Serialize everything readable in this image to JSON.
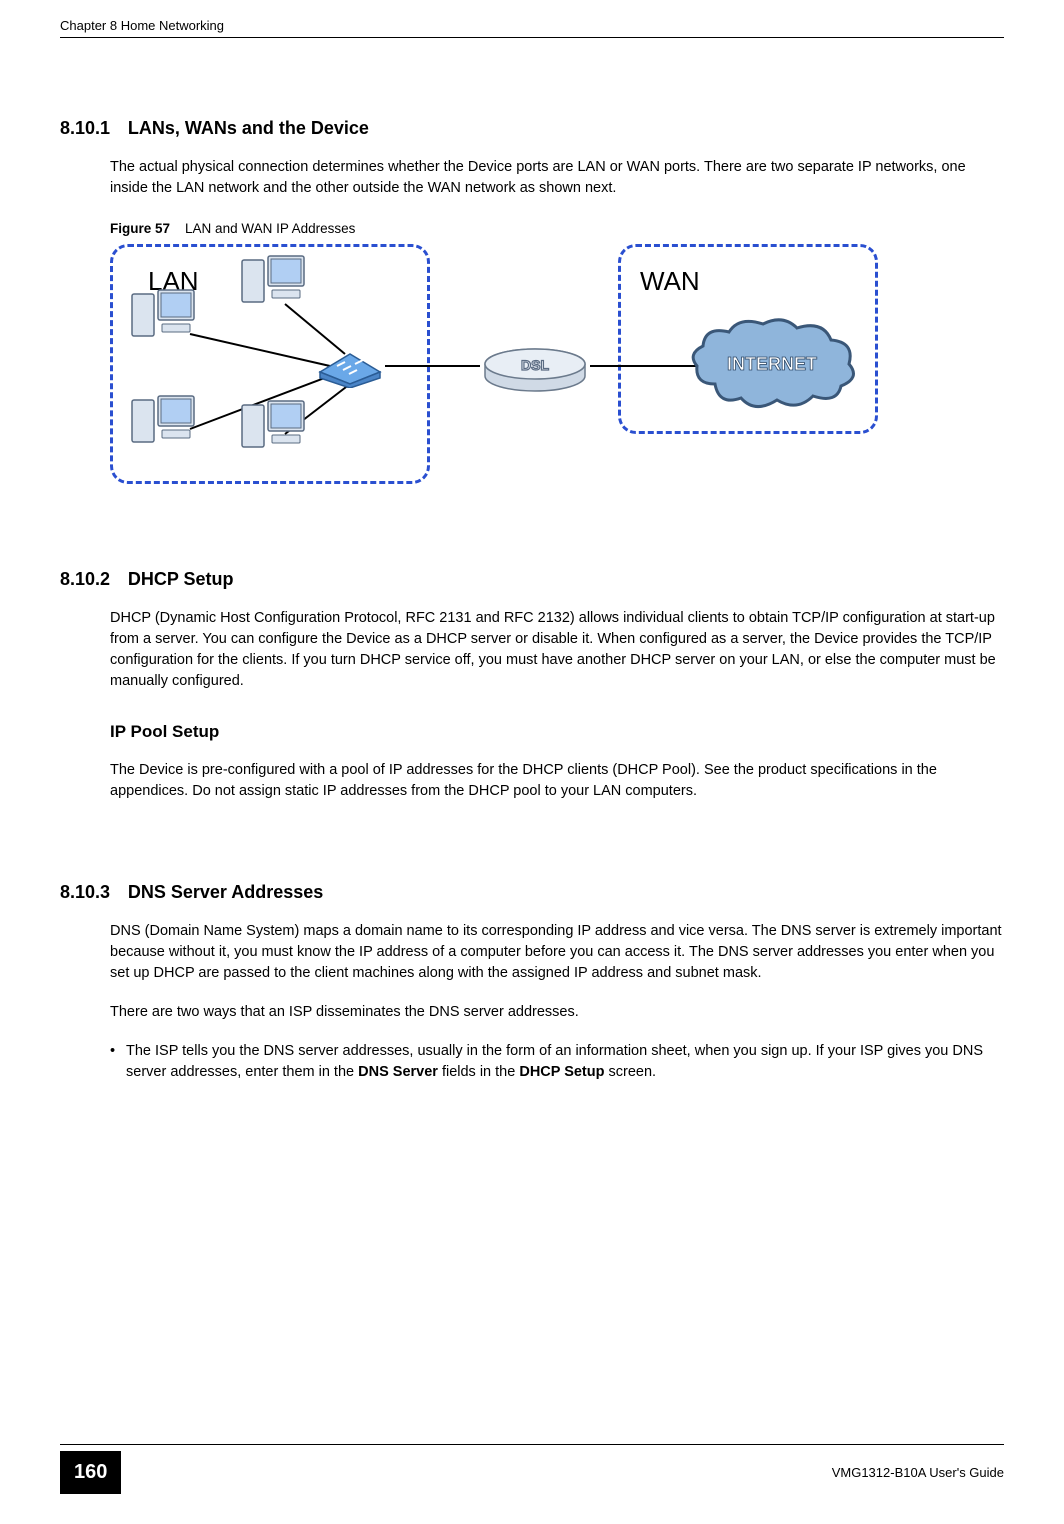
{
  "header": {
    "chapter": "Chapter 8 Home Networking"
  },
  "sections": {
    "s1": {
      "num": "8.10.1",
      "title": "LANs, WANs and the Device",
      "body": "The actual physical connection determines whether the Device ports are LAN or WAN ports. There are two separate IP networks, one inside the LAN network and the other outside the WAN network as shown next."
    },
    "figure": {
      "label": "Figure 57",
      "caption": "LAN and WAN IP Addresses",
      "lan_label": "LAN",
      "wan_label": "WAN",
      "dsl_text": "DSL",
      "internet_text": "INTERNET"
    },
    "s2": {
      "num": "8.10.2",
      "title": "DHCP Setup",
      "body": "DHCP (Dynamic Host Configuration Protocol, RFC 2131 and RFC 2132) allows individual clients to obtain TCP/IP configuration at start-up from a server. You can configure the Device as a DHCP server or disable it. When configured as a server, the Device provides the TCP/IP configuration for the clients. If you turn DHCP service off, you must have another DHCP server on your LAN, or else the computer must be manually configured.",
      "sub_title": "IP Pool Setup",
      "sub_body": "The Device is pre-configured with a pool of IP addresses for the DHCP clients (DHCP Pool). See the product specifications in the appendices. Do not assign static IP addresses from the DHCP pool to your LAN computers."
    },
    "s3": {
      "num": "8.10.3",
      "title": "DNS Server Addresses",
      "body1": "DNS (Domain Name System) maps a domain name to its corresponding IP address and vice versa. The DNS server is extremely important because without it, you must know the IP address of a computer before you can access it. The DNS server addresses you enter when you set up DHCP are passed to the client machines along with the assigned IP address and subnet mask.",
      "body2": "There are two ways that an ISP disseminates the DNS server addresses.",
      "bullet_pre": "The ISP tells you the DNS server addresses, usually in the form of an information sheet, when you sign up. If your ISP gives you DNS server addresses, enter them in the ",
      "bullet_bold1": "DNS Server",
      "bullet_mid": " fields in the ",
      "bullet_bold2": "DHCP Setup",
      "bullet_post": " screen."
    }
  },
  "footer": {
    "page": "160",
    "guide": "VMG1312-B10A User's Guide"
  }
}
